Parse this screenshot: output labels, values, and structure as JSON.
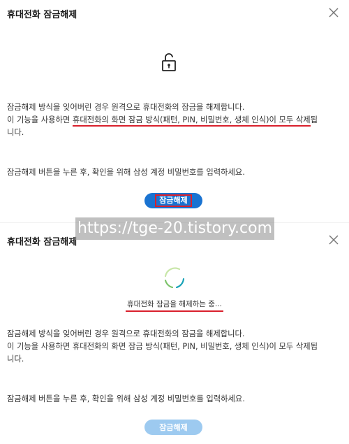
{
  "top_dialog": {
    "title": "휴대전화 잠금해제",
    "desc_line1": "잠금해제 방식을 잊어버린 경우 원격으로 휴대전화의 잠금을 해제합니다.",
    "desc_line2_prefix": "이 기능을 사용하면 ",
    "desc_line2_highlight": "휴대전화의 화면 잠금 방식(패턴, PIN, 비밀번호, 생체 인식)이 모두 삭제",
    "desc_line2_suffix": "됩",
    "desc_line3": "니다.",
    "instruction": "잠금해제 버튼을 누른 후, 확인을 위해 삼성 계정 비밀번호를 입력하세요.",
    "button_label": "잠금해제"
  },
  "bottom_dialog": {
    "title": "휴대전화 잠금해제",
    "progress_text": "휴대전화 잠금을 해제하는 중...",
    "desc_line1": "잠금해제 방식을 잊어버린 경우 원격으로 휴대전화의 잠금을 해제합니다.",
    "desc_line2": "이 기능을 사용하면 휴대전화의 화면 잠금 방식(패턴, PIN, 비밀번호, 생체 인식)이 모두 삭제됩",
    "desc_line3": "니다.",
    "instruction": "잠금해제 버튼을 누른 후, 확인을 위해 삼성 계정 비밀번호를 입력하세요.",
    "button_label": "잠금해제"
  },
  "watermark": "https://tge-20.tistory.com",
  "colors": {
    "button_blue": "#1a73d1",
    "button_disabled": "#9dcaf0",
    "highlight_red": "#d9202c"
  }
}
